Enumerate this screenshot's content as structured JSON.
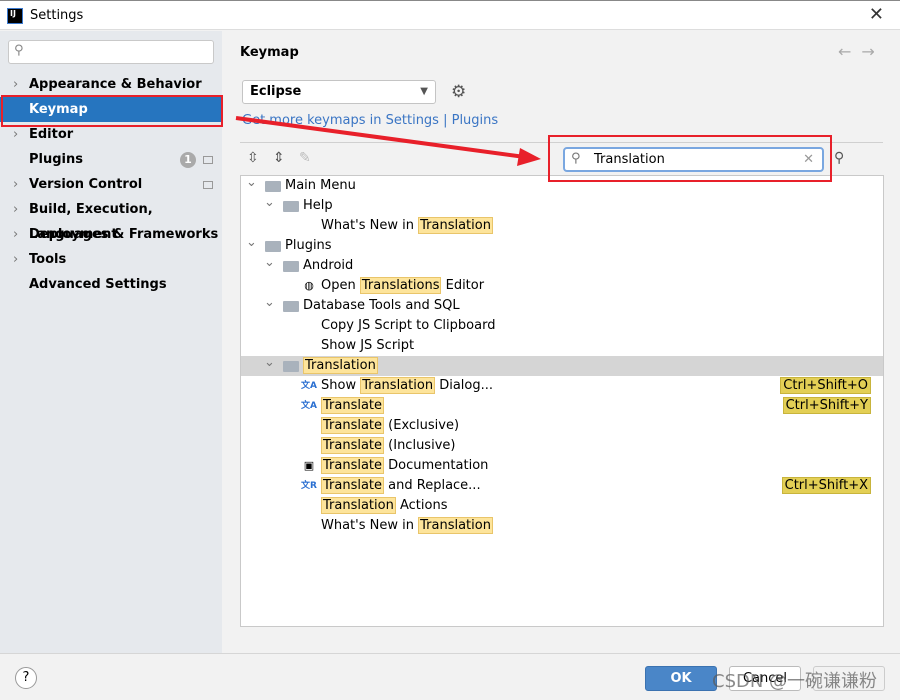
{
  "window": {
    "title": "Settings",
    "close": "✕"
  },
  "sidebar": {
    "search_placeholder": "",
    "items": [
      {
        "label": "Appearance & Behavior",
        "chevron": true
      },
      {
        "label": "Keymap",
        "selected": true
      },
      {
        "label": "Editor",
        "chevron": true
      },
      {
        "label": "Plugins",
        "badge": "1"
      },
      {
        "label": "Version Control",
        "chevron": true
      },
      {
        "label": "Build, Execution, Deployment",
        "chevron": true
      },
      {
        "label": "Languages & Frameworks",
        "chevron": true
      },
      {
        "label": "Tools",
        "chevron": true
      },
      {
        "label": "Advanced Settings"
      }
    ]
  },
  "main": {
    "title": "Keymap",
    "keymap_select": "Eclipse",
    "link": "Get more keymaps in Settings | Plugins",
    "search_value": "Translation",
    "tree": [
      {
        "level": 0,
        "chev": true,
        "icon": "main-menu-icon",
        "parts": [
          [
            "Main Menu",
            0
          ]
        ]
      },
      {
        "level": 1,
        "chev": true,
        "icon": "folder-icon",
        "parts": [
          [
            "Help",
            0
          ]
        ]
      },
      {
        "level": 2,
        "parts": [
          [
            "What's New in ",
            0
          ],
          [
            "Translation",
            1
          ]
        ]
      },
      {
        "level": 0,
        "chev": true,
        "icon": "folder-icon",
        "parts": [
          [
            "Plugins",
            0
          ]
        ]
      },
      {
        "level": 1,
        "chev": true,
        "icon": "folder-icon",
        "parts": [
          [
            "Android",
            0
          ]
        ]
      },
      {
        "level": 2,
        "icon": "globe-icon",
        "parts": [
          [
            "Open ",
            0
          ],
          [
            "Translations",
            1
          ],
          [
            " Editor",
            0
          ]
        ]
      },
      {
        "level": 1,
        "chev": true,
        "icon": "folder-icon",
        "parts": [
          [
            "Database Tools and SQL",
            0
          ]
        ]
      },
      {
        "level": 2,
        "parts": [
          [
            "Copy JS Script to Clipboard",
            0
          ]
        ]
      },
      {
        "level": 2,
        "parts": [
          [
            "Show JS Script",
            0
          ]
        ]
      },
      {
        "level": 1,
        "chev": true,
        "icon": "folder-icon",
        "highlight": true,
        "parts": [
          [
            "Translation",
            1
          ]
        ]
      },
      {
        "level": 2,
        "icon": "translate-icon",
        "parts": [
          [
            "Show ",
            0
          ],
          [
            "Translation",
            1
          ],
          [
            " Dialog...",
            0
          ]
        ],
        "shortcut": "Ctrl+Shift+O"
      },
      {
        "level": 2,
        "icon": "translate-icon",
        "parts": [
          [
            "Translate",
            1
          ]
        ],
        "shortcut": "Ctrl+Shift+Y"
      },
      {
        "level": 2,
        "parts": [
          [
            "Translate",
            1
          ],
          [
            " (Exclusive)",
            0
          ]
        ]
      },
      {
        "level": 2,
        "parts": [
          [
            "Translate",
            1
          ],
          [
            " (Inclusive)",
            0
          ]
        ]
      },
      {
        "level": 2,
        "icon": "document-translate-icon",
        "parts": [
          [
            "Translate",
            1
          ],
          [
            " Documentation",
            0
          ]
        ]
      },
      {
        "level": 2,
        "icon": "translate-replace-icon",
        "parts": [
          [
            "Translate",
            1
          ],
          [
            " and Replace...",
            0
          ]
        ],
        "shortcut": "Ctrl+Shift+X"
      },
      {
        "level": 2,
        "parts": [
          [
            "Translation",
            1
          ],
          [
            " Actions",
            0
          ]
        ]
      },
      {
        "level": 2,
        "parts": [
          [
            "What's New in ",
            0
          ],
          [
            "Translation",
            1
          ]
        ]
      }
    ]
  },
  "footer": {
    "help": "?",
    "ok": "OK",
    "cancel": "Cancel",
    "apply": ""
  },
  "watermark": "CSDN @一碗谦谦粉",
  "colors": {
    "accent": "#2675bf",
    "match": "#fde49b",
    "shortcut": "#e3cf55",
    "annotation": "#e8202a"
  }
}
